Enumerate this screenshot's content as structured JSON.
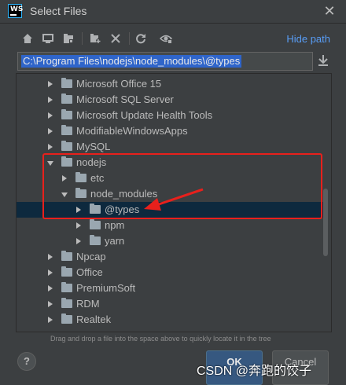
{
  "window": {
    "title": "Select Files",
    "logo_text": "WS"
  },
  "toolbar": {
    "buttons": [
      "home-icon",
      "desktop-icon",
      "project-icon",
      "new-folder-icon",
      "delete-icon",
      "refresh-icon",
      "show-hidden-icon"
    ],
    "hide_path_label": "Hide path"
  },
  "path": {
    "value": "C:\\Program Files\\nodejs\\node_modules\\@types"
  },
  "tree": {
    "items": [
      {
        "label": "Microsoft Office 15",
        "expanded": false
      },
      {
        "label": "Microsoft SQL Server",
        "expanded": false
      },
      {
        "label": "Microsoft Update Health Tools",
        "expanded": false
      },
      {
        "label": "ModifiableWindowsApps",
        "expanded": false
      },
      {
        "label": "MySQL",
        "expanded": false
      },
      {
        "label": "nodejs",
        "expanded": true
      },
      {
        "label": "etc",
        "expanded": false
      },
      {
        "label": "node_modules",
        "expanded": true
      },
      {
        "label": "@types",
        "expanded": false,
        "selected": true
      },
      {
        "label": "npm",
        "expanded": false
      },
      {
        "label": "yarn",
        "expanded": false
      },
      {
        "label": "Npcap",
        "expanded": false
      },
      {
        "label": "Office",
        "expanded": false
      },
      {
        "label": "PremiumSoft",
        "expanded": false
      },
      {
        "label": "RDM",
        "expanded": false
      },
      {
        "label": "Realtek",
        "expanded": false
      }
    ]
  },
  "hint": "Drag and drop a file into the space above to quickly locate it in the tree",
  "buttons": {
    "help": "?",
    "ok": "OK",
    "cancel": "Cancel"
  },
  "watermark": "CSDN @奔跑的饺子",
  "colors": {
    "accent": "#589df6",
    "selection": "#0d293e",
    "annotation": "#e8201c",
    "ok_button": "#365880"
  }
}
